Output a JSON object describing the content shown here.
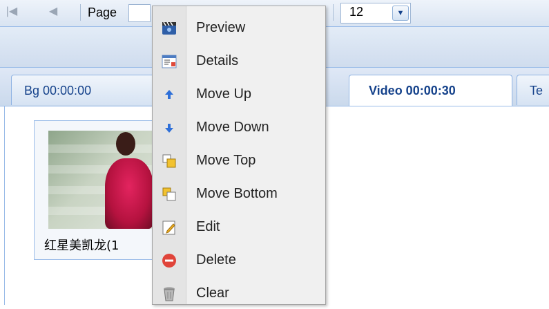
{
  "pager": {
    "first_icon": "first-page-icon",
    "prev_icon": "prev-page-icon",
    "page_label": "Page",
    "page_size": "12"
  },
  "tabs": [
    {
      "label": "Bg   00:00:00",
      "active": false
    },
    {
      "label": "Video 00:00:30",
      "active": true
    },
    {
      "label": "Te",
      "active": false
    }
  ],
  "thumbnail": {
    "caption": "红星美凯龙(1"
  },
  "context_menu": {
    "items": [
      {
        "label": "Preview",
        "icon": "preview-icon"
      },
      {
        "label": "Details",
        "icon": "details-icon"
      },
      {
        "label": "Move Up",
        "icon": "move-up-icon"
      },
      {
        "label": "Move Down",
        "icon": "move-down-icon"
      },
      {
        "label": "Move Top",
        "icon": "move-top-icon"
      },
      {
        "label": "Move Bottom",
        "icon": "move-bottom-icon"
      },
      {
        "label": "Edit",
        "icon": "edit-icon"
      },
      {
        "label": "Delete",
        "icon": "delete-icon"
      },
      {
        "label": "Clear",
        "icon": "clear-icon"
      }
    ]
  },
  "colors": {
    "accent": "#15428b",
    "border": "#99bbe8",
    "delete_red": "#e0443a"
  }
}
